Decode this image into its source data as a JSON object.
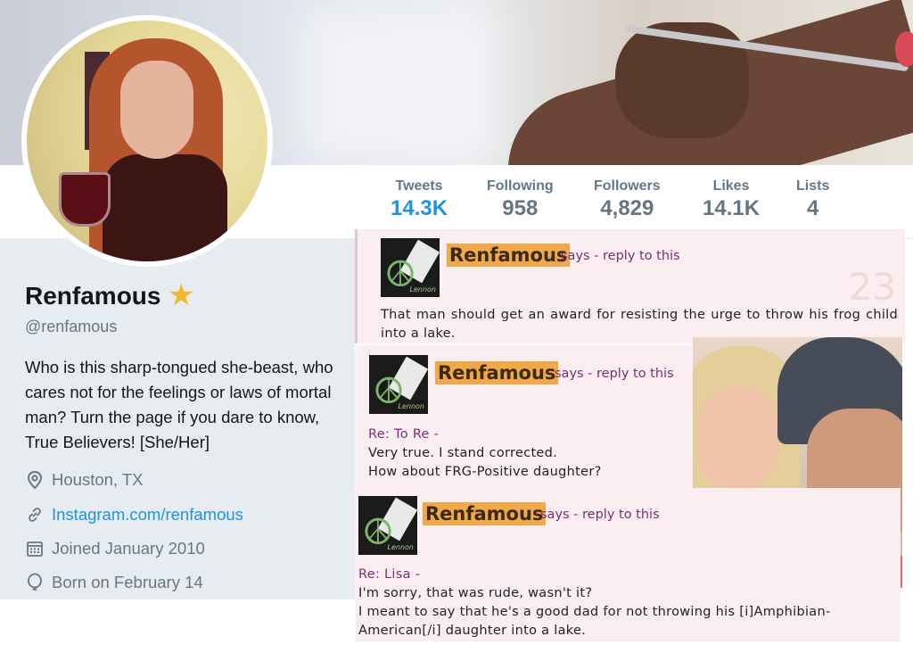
{
  "profile": {
    "name": "Renfamous",
    "handle": "@renfamous",
    "bio": "Who is this sharp-tongued she-beast, who cares not for the feelings or laws of mortal man? Turn the page if you dare to know, True Believers! [She/Her]",
    "location": "Houston, TX",
    "website": "Instagram.com/renfamous",
    "joined": "Joined January 2010",
    "born": "Born on February 14",
    "icons": {
      "verified": "star-icon",
      "location": "location-pin-icon",
      "link": "link-icon",
      "calendar": "calendar-icon",
      "birthday": "balloon-icon"
    }
  },
  "stats": [
    {
      "label": "Tweets",
      "value": "14.3K"
    },
    {
      "label": "Following",
      "value": "958"
    },
    {
      "label": "Followers",
      "value": "4,829"
    },
    {
      "label": "Likes",
      "value": "14.1K"
    },
    {
      "label": "Lists",
      "value": "4"
    }
  ],
  "comments": [
    {
      "author": "Renfamous",
      "says": "says -",
      "reply_link": "reply to this",
      "count": "23",
      "thumb_text": "Lennon",
      "re": "",
      "lines": [
        "That man should get an award for resisting the urge to throw his frog child into a lake."
      ]
    },
    {
      "author": "Renfamous",
      "says": "says -",
      "reply_link": "reply to this",
      "thumb_text": "Lennon",
      "re": "Re: To Re -",
      "lines": [
        "Very true. I stand corrected.",
        "How about FRG-Positive daughter?"
      ]
    },
    {
      "author": "Renfamous",
      "says": "says -",
      "reply_link": "reply to this",
      "thumb_text": "Lennon",
      "re": "Re: Lisa -",
      "lines": [
        "I'm sorry, that was rude, wasn't it?",
        "I meant to say that he's a good dad for not throwing his [i]Amphibian-American[/i] daughter into a lake."
      ]
    }
  ],
  "colors": {
    "accent": "#1b95e0",
    "star": "#f5b731",
    "comment_bg": "#fbeef0",
    "name_highlight": "#f0a848",
    "says_purple": "#7a2e78"
  }
}
